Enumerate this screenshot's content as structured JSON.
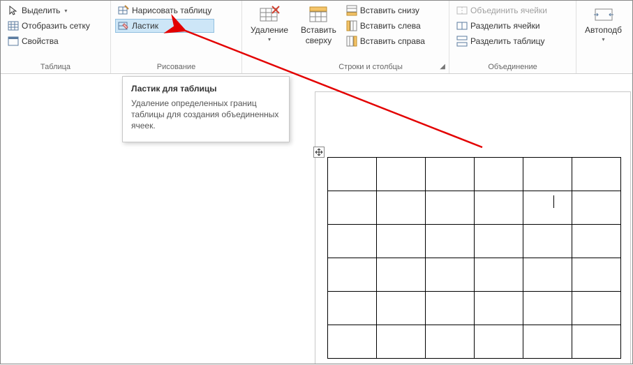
{
  "ribbon": {
    "table_group": {
      "label": "Таблица",
      "select": "Выделить",
      "gridlines": "Отобразить сетку",
      "properties": "Свойства"
    },
    "draw_group": {
      "label": "Рисование",
      "draw_table": "Нарисовать таблицу",
      "eraser": "Ластик"
    },
    "delete_group": {
      "delete": "Удаление"
    },
    "insert_group": {
      "insert_above_l1": "Вставить",
      "insert_above_l2": "сверху",
      "insert_below": "Вставить снизу",
      "insert_left": "Вставить слева",
      "insert_right": "Вставить справа",
      "rows_cols_label": "Строки и столбцы"
    },
    "merge_group": {
      "label": "Объединение",
      "merge_cells": "Объединить ячейки",
      "split_cells": "Разделить ячейки",
      "split_table": "Разделить таблицу"
    },
    "autofit": "Автоподб"
  },
  "tooltip": {
    "title": "Ластик для таблицы",
    "body": "Удаление определенных границ таблицы для создания объединенных ячеек."
  },
  "doc_table": {
    "rows": 6,
    "cols": 6
  }
}
